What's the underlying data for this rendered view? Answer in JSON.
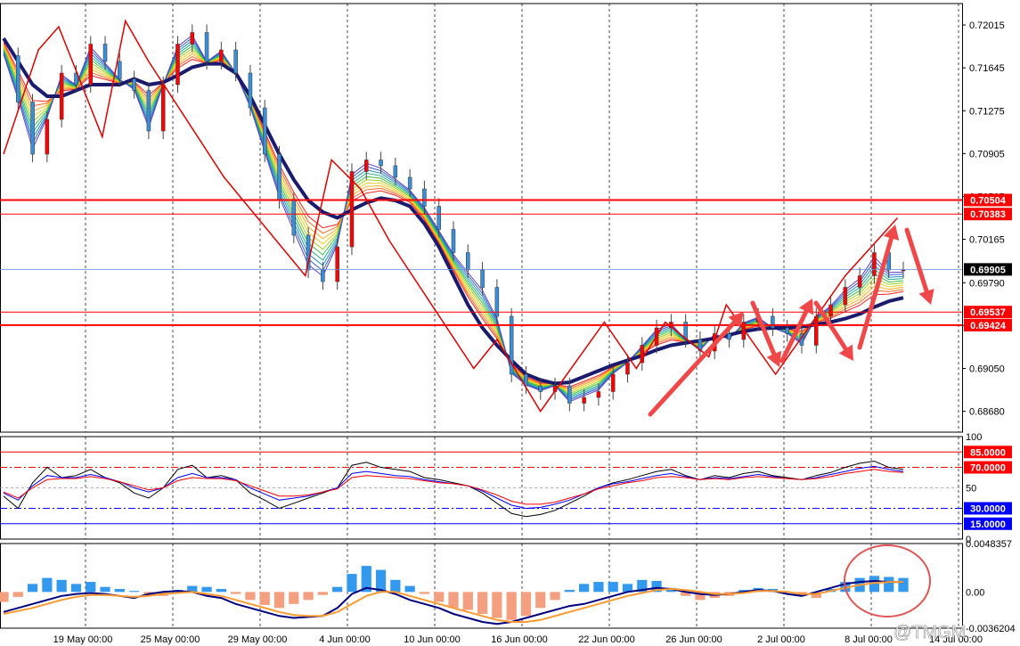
{
  "chart_data": [
    {
      "type": "line",
      "panel": "price",
      "y_ticks": [
        "0.72015",
        "0.71645",
        "0.71275",
        "0.70905",
        "0.70535",
        "0.70165",
        "0.69790",
        "0.69420",
        "0.69050",
        "0.68680"
      ],
      "ylim": [
        0.685,
        0.722
      ],
      "x_labels": [
        "19 May 00:00",
        "25 May 00:00",
        "29 May 00:00",
        "4 Jun 00:00",
        "10 Jun 00:00",
        "16 Jun 00:00",
        "22 Jun 00:00",
        "26 Jun 00:00",
        "2 Jul 00:00",
        "8 Jul 00:00",
        "14 Jul 00:00"
      ],
      "x": [
        0,
        5,
        10,
        15,
        20,
        25,
        30,
        35,
        40,
        45,
        50,
        55,
        60,
        65,
        70,
        75,
        80,
        85,
        90,
        95,
        100,
        105,
        110,
        115,
        120,
        125,
        130,
        135,
        140,
        145,
        150,
        155,
        160,
        165,
        170,
        175,
        180,
        185,
        190,
        195,
        200,
        205,
        210,
        215,
        220,
        225,
        230,
        235,
        240,
        245,
        250,
        255,
        260,
        265,
        270,
        275,
        280,
        285,
        290,
        295,
        300,
        305,
        310
      ],
      "close": [
        0.7175,
        0.7135,
        0.709,
        0.712,
        0.716,
        0.715,
        0.7185,
        0.717,
        0.7155,
        0.7145,
        0.711,
        0.715,
        0.7185,
        0.7195,
        0.717,
        0.718,
        0.716,
        0.713,
        0.709,
        0.705,
        0.702,
        0.699,
        0.698,
        0.701,
        0.7075,
        0.7085,
        0.708,
        0.707,
        0.706,
        0.7045,
        0.7025,
        0.7005,
        0.699,
        0.6975,
        0.695,
        0.69,
        0.689,
        0.6885,
        0.689,
        0.6875,
        0.688,
        0.6885,
        0.69,
        0.691,
        0.6925,
        0.694,
        0.6945,
        0.693,
        0.692,
        0.6935,
        0.693,
        0.6945,
        0.695,
        0.694,
        0.6935,
        0.6925,
        0.695,
        0.696,
        0.6975,
        0.6985,
        0.7005,
        0.699,
        0.699
      ],
      "ma_thick": [
        0.719,
        0.717,
        0.715,
        0.714,
        0.714,
        0.7145,
        0.715,
        0.715,
        0.715,
        0.7155,
        0.715,
        0.7152,
        0.7158,
        0.7165,
        0.7168,
        0.7168,
        0.716,
        0.714,
        0.7115,
        0.709,
        0.7068,
        0.705,
        0.704,
        0.7035,
        0.7042,
        0.7048,
        0.7052,
        0.705,
        0.7045,
        0.703,
        0.701,
        0.6985,
        0.696,
        0.694,
        0.6925,
        0.6912,
        0.69,
        0.6895,
        0.6892,
        0.6893,
        0.6898,
        0.6903,
        0.6908,
        0.6912,
        0.6916,
        0.6921,
        0.6925,
        0.6927,
        0.6929,
        0.6931,
        0.6934,
        0.6937,
        0.6939,
        0.694,
        0.694,
        0.6941,
        0.6943,
        0.6945,
        0.6948,
        0.6952,
        0.6958,
        0.6963,
        0.6966
      ],
      "h_lines": [
        {
          "value": 0.70504,
          "label": "0.70504",
          "color": "#ff0000"
        },
        {
          "value": 0.70383,
          "label": "0.70383",
          "color": "#ff0000"
        },
        {
          "value": 0.69905,
          "label": "0.69905",
          "color": "#000000"
        },
        {
          "value": 0.69537,
          "label": "0.69537",
          "color": "#ff0000"
        },
        {
          "value": 0.69424,
          "label": "0.69424",
          "color": "#ff0000"
        }
      ],
      "zigzag": [
        [
          0,
          0.709
        ],
        [
          12,
          0.718
        ],
        [
          19,
          0.72
        ],
        [
          34,
          0.7105
        ],
        [
          42,
          0.7205
        ],
        [
          50,
          0.717
        ],
        [
          76,
          0.707
        ],
        [
          104,
          0.6985
        ],
        [
          113,
          0.7085
        ],
        [
          123,
          0.706
        ],
        [
          133,
          0.7015
        ],
        [
          162,
          0.6905
        ],
        [
          170,
          0.693
        ],
        [
          185,
          0.6868
        ],
        [
          207,
          0.6945
        ],
        [
          218,
          0.6905
        ],
        [
          228,
          0.6945
        ],
        [
          243,
          0.6915
        ],
        [
          249,
          0.696
        ],
        [
          266,
          0.69
        ],
        [
          290,
          0.6985
        ],
        [
          308,
          0.7035
        ]
      ],
      "colors": {
        "bull": "#ff0000",
        "bear": "#3a8fd8",
        "ma_thick": "#1a1a6e",
        "zigzag": "#dd0000",
        "arrow": "#f04848"
      }
    },
    {
      "type": "line",
      "panel": "oscillator",
      "ylim": [
        0,
        100
      ],
      "y_ticks": [
        "100",
        "50",
        "0"
      ],
      "levels": [
        {
          "value": 85,
          "label": "85.0000",
          "color": "#ff0000"
        },
        {
          "value": 70,
          "label": "70.0000",
          "color": "#ff0000"
        },
        {
          "value": 30,
          "label": "30.0000",
          "color": "#0000ff"
        },
        {
          "value": 15,
          "label": "15.0000",
          "color": "#0000ff"
        }
      ],
      "series": [
        {
          "values": [
            42,
            30,
            55,
            70,
            60,
            62,
            68,
            60,
            55,
            45,
            40,
            50,
            68,
            72,
            60,
            62,
            58,
            45,
            38,
            30,
            35,
            40,
            45,
            50,
            72,
            75,
            70,
            68,
            66,
            60,
            58,
            55,
            52,
            45,
            35,
            25,
            22,
            24,
            28,
            35,
            42,
            50,
            55,
            58,
            62,
            66,
            68,
            62,
            58,
            62,
            60,
            64,
            66,
            62,
            60,
            58,
            62,
            65,
            70,
            74,
            76,
            70,
            68
          ],
          "color": "#000000"
        },
        {
          "values": [
            45,
            38,
            52,
            62,
            60,
            60,
            63,
            60,
            56,
            50,
            46,
            50,
            60,
            64,
            60,
            60,
            58,
            50,
            44,
            38,
            40,
            42,
            46,
            50,
            64,
            66,
            64,
            62,
            61,
            58,
            56,
            54,
            52,
            47,
            40,
            33,
            30,
            31,
            34,
            38,
            44,
            50,
            54,
            56,
            59,
            62,
            64,
            61,
            58,
            60,
            59,
            61,
            63,
            61,
            59,
            58,
            60,
            63,
            66,
            69,
            71,
            68,
            66
          ],
          "color": "#0000ff"
        },
        {
          "values": [
            46,
            40,
            50,
            58,
            59,
            59,
            61,
            59,
            56,
            52,
            48,
            50,
            57,
            60,
            59,
            59,
            57,
            52,
            47,
            42,
            42,
            43,
            46,
            49,
            60,
            62,
            61,
            60,
            59,
            57,
            55,
            54,
            52,
            48,
            43,
            37,
            34,
            34,
            36,
            40,
            44,
            49,
            52,
            55,
            57,
            60,
            61,
            60,
            58,
            59,
            58,
            60,
            61,
            60,
            59,
            58,
            59,
            61,
            64,
            66,
            68,
            66,
            65
          ],
          "color": "#ff0000"
        }
      ]
    },
    {
      "type": "bar",
      "panel": "macd",
      "ylim": [
        -0.0036204,
        0.0048357
      ],
      "y_ticks": [
        "0.0048357",
        "0.00",
        "-0.0036204"
      ],
      "histogram": [
        -0.001,
        -0.0005,
        0.0008,
        0.0014,
        0.0012,
        0.0008,
        0.001,
        0.0005,
        0.0003,
        0.0001,
        -0.0003,
        -0.0004,
        0.0002,
        0.0006,
        0.0005,
        0.0003,
        -0.0002,
        -0.0008,
        -0.0013,
        -0.0016,
        -0.0012,
        -0.0008,
        -0.0003,
        0.0005,
        0.0018,
        0.0026,
        0.0022,
        0.0012,
        0.0006,
        -0.0002,
        -0.001,
        -0.0016,
        -0.0018,
        -0.0022,
        -0.0026,
        -0.0028,
        -0.0024,
        -0.0016,
        -0.0008,
        0.0002,
        0.0008,
        0.001,
        0.001,
        0.0008,
        0.0012,
        0.0011,
        0.0004,
        -0.0004,
        -0.0008,
        -0.0006,
        -0.0004,
        0.0002,
        0.0004,
        0.0003,
        0.0,
        -0.0004,
        -0.0006,
        0.0003,
        0.001,
        0.0014,
        0.0016,
        0.0015,
        0.0014
      ],
      "macd_line": [
        -0.002,
        -0.0016,
        -0.0012,
        -0.0008,
        -0.0004,
        -0.0002,
        -0.0001,
        -0.0002,
        -0.0004,
        -0.0006,
        -0.0002,
        0.0,
        0.0001,
        0.0,
        -0.0004,
        -0.0006,
        -0.0012,
        -0.0016,
        -0.002,
        -0.0024,
        -0.0026,
        -0.0025,
        -0.0024,
        -0.0016,
        -0.0002,
        0.0004,
        0.0002,
        -0.0002,
        -0.0008,
        -0.0012,
        -0.0016,
        -0.0022,
        -0.0026,
        -0.003,
        -0.0032,
        -0.003,
        -0.0026,
        -0.0022,
        -0.0018,
        -0.0014,
        -0.0012,
        -0.0008,
        -0.0004,
        0.0,
        0.0002,
        0.0004,
        0.0003,
        0.0,
        -0.0002,
        -0.0003,
        -0.0002,
        0.0,
        0.0002,
        0.0001,
        -0.0002,
        -0.0004,
        0.0,
        0.0004,
        0.0008,
        0.001,
        0.0011,
        0.001,
        0.001
      ],
      "signal_line": [
        -0.0022,
        -0.0019,
        -0.0016,
        -0.0012,
        -0.0008,
        -0.0005,
        -0.0003,
        -0.0003,
        -0.0004,
        -0.0005,
        -0.0004,
        -0.0002,
        -0.0001,
        0.0,
        -0.0002,
        -0.0004,
        -0.0008,
        -0.0012,
        -0.0016,
        -0.002,
        -0.0023,
        -0.0024,
        -0.0024,
        -0.002,
        -0.0012,
        -0.0004,
        0.0,
        0.0,
        -0.0004,
        -0.0008,
        -0.0012,
        -0.0016,
        -0.002,
        -0.0024,
        -0.0028,
        -0.003,
        -0.003,
        -0.0028,
        -0.0024,
        -0.002,
        -0.0016,
        -0.0012,
        -0.0008,
        -0.0004,
        -0.0001,
        0.0002,
        0.0003,
        0.0002,
        0.0,
        -0.0002,
        -0.0002,
        -0.0001,
        0.0001,
        0.0001,
        0.0,
        -0.0002,
        -0.0002,
        0.0001,
        0.0004,
        0.0007,
        0.0009,
        0.001,
        0.001
      ],
      "colors": {
        "positive": "#3399ee",
        "negative": "#f4a080",
        "macd": "#000080",
        "signal": "#ff9a30",
        "highlight": "#e05555"
      }
    }
  ],
  "watermark": "@TMGM"
}
